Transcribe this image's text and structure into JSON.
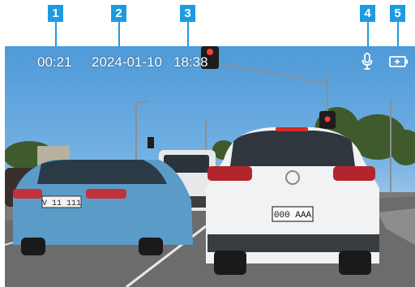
{
  "callouts": [
    "1",
    "2",
    "3",
    "4",
    "5"
  ],
  "overlay": {
    "elapsed": "00:21",
    "date": "2024-01-10",
    "time": "18:38"
  },
  "icons": [
    "microphone-icon",
    "battery-charging-icon"
  ],
  "plates": {
    "left_car": "V 11 111",
    "right_car": "000 AAA"
  },
  "colors": {
    "callout": "#1e9be0",
    "overlay_text": "#ffffff"
  }
}
